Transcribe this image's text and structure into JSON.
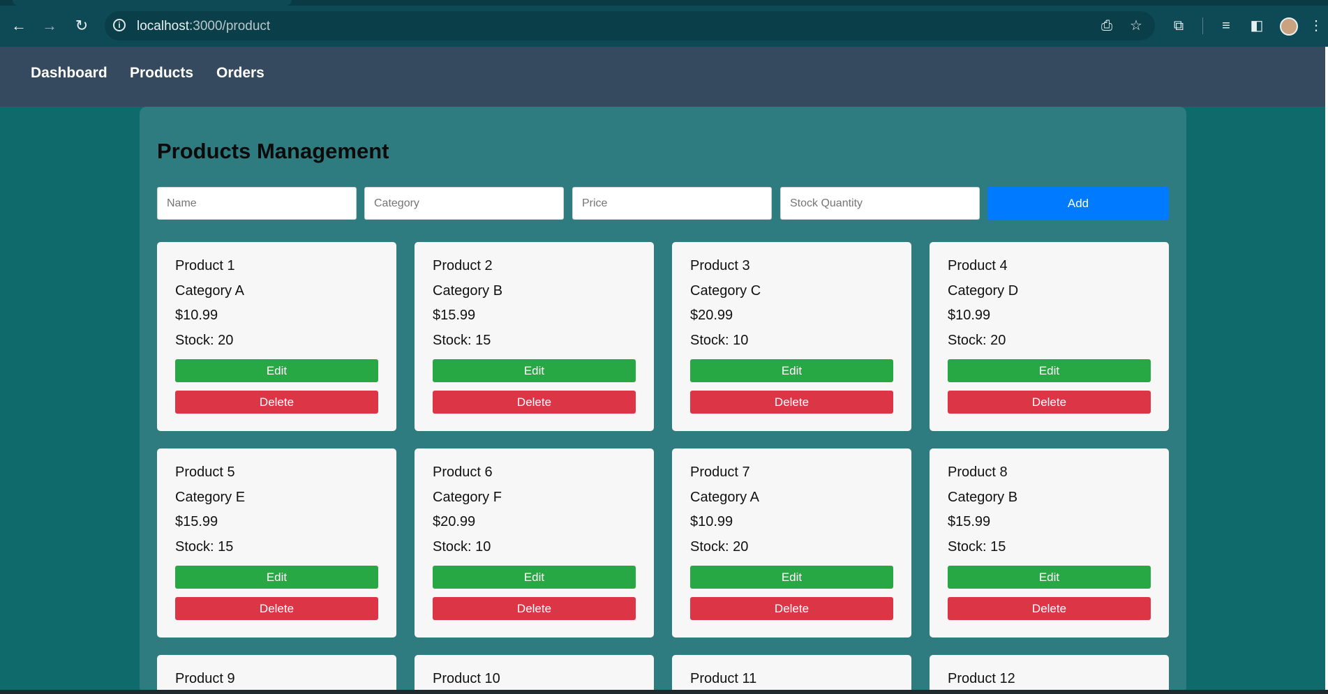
{
  "browser": {
    "url_host": "localhost",
    "url_path": ":3000/product",
    "back_icon": "←",
    "forward_icon": "→",
    "reload_icon": "↻",
    "info_icon": "i",
    "install_icon": "⎙",
    "star_icon": "☆",
    "extensions_icon": "⧉",
    "media_icon": "≡",
    "sidepanel_icon": "◧",
    "menu_icon": "⋮"
  },
  "nav": {
    "dashboard": "Dashboard",
    "products": "Products",
    "orders": "Orders"
  },
  "page": {
    "title": "Products Management",
    "form": {
      "name_placeholder": "Name",
      "category_placeholder": "Category",
      "price_placeholder": "Price",
      "stock_placeholder": "Stock Quantity",
      "add_label": "Add"
    }
  },
  "products": [
    {
      "name": "Product 1",
      "category": "Category A",
      "price": "$10.99",
      "stock": "Stock: 20",
      "edit": "Edit",
      "delete": "Delete"
    },
    {
      "name": "Product 2",
      "category": "Category B",
      "price": "$15.99",
      "stock": "Stock: 15",
      "edit": "Edit",
      "delete": "Delete"
    },
    {
      "name": "Product 3",
      "category": "Category C",
      "price": "$20.99",
      "stock": "Stock: 10",
      "edit": "Edit",
      "delete": "Delete"
    },
    {
      "name": "Product 4",
      "category": "Category D",
      "price": "$10.99",
      "stock": "Stock: 20",
      "edit": "Edit",
      "delete": "Delete"
    },
    {
      "name": "Product 5",
      "category": "Category E",
      "price": "$15.99",
      "stock": "Stock: 15",
      "edit": "Edit",
      "delete": "Delete"
    },
    {
      "name": "Product 6",
      "category": "Category F",
      "price": "$20.99",
      "stock": "Stock: 10",
      "edit": "Edit",
      "delete": "Delete"
    },
    {
      "name": "Product 7",
      "category": "Category A",
      "price": "$10.99",
      "stock": "Stock: 20",
      "edit": "Edit",
      "delete": "Delete"
    },
    {
      "name": "Product 8",
      "category": "Category B",
      "price": "$15.99",
      "stock": "Stock: 15",
      "edit": "Edit",
      "delete": "Delete"
    },
    {
      "name": "Product 9"
    },
    {
      "name": "Product 10"
    },
    {
      "name": "Product 11"
    },
    {
      "name": "Product 12"
    }
  ]
}
